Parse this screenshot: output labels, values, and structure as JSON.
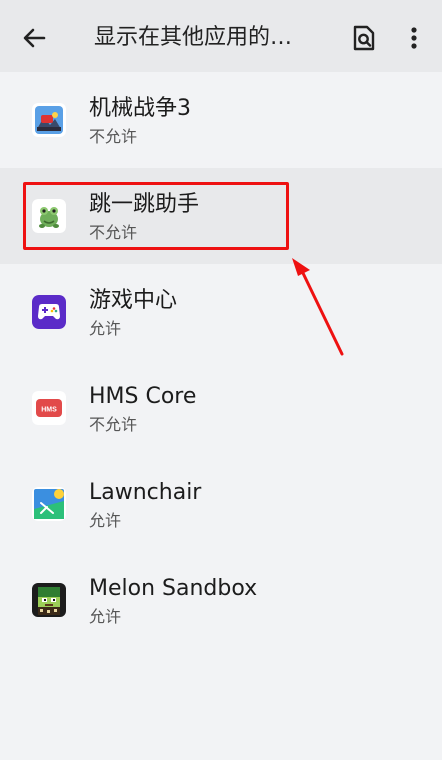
{
  "header": {
    "title": "显示在其他应用的…",
    "back_icon": "arrow-back-icon",
    "search_icon": "document-search-icon",
    "more_icon": "more-vert-icon"
  },
  "apps": [
    {
      "name": "机械战争3",
      "status": "不允许",
      "icon": "mechanical-war-3-icon"
    },
    {
      "name": "跳一跳助手",
      "status": "不允许",
      "icon": "frog-icon",
      "selected": true
    },
    {
      "name": "游戏中心",
      "status": "允许",
      "icon": "gamepad-icon"
    },
    {
      "name": "HMS Core",
      "status": "不允许",
      "icon": "hms-icon",
      "icon_text": "HMS"
    },
    {
      "name": "Lawnchair",
      "status": "允许",
      "icon": "lawnchair-icon"
    },
    {
      "name": "Melon Sandbox",
      "status": "允许",
      "icon": "melon-sandbox-icon"
    }
  ],
  "colors": {
    "highlight": "#ee1111",
    "toolbar_bg": "#e8e9eb",
    "page_bg": "#f2f3f5",
    "game_center_purple": "#5b2bc8"
  }
}
